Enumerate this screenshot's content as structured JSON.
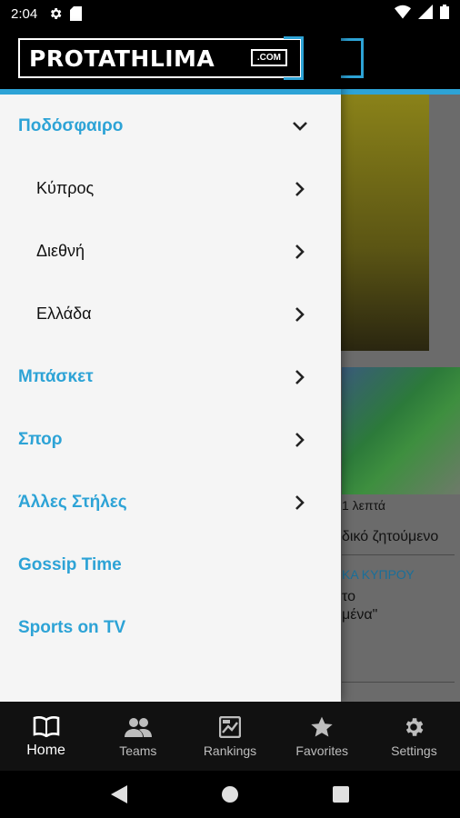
{
  "status_bar": {
    "time": "2:04"
  },
  "background": {
    "time_ago": "1 λεπτά",
    "headline_fragment": "δικό ζητούμενο",
    "category_fragment": "ΚΑ ΚΥΠΡΟΥ",
    "teaser_line1": "το",
    "teaser_line2": "μένα\""
  },
  "drawer": {
    "logo_text": "PROTATHLIMA",
    "logo_tld": ".COM",
    "menu": [
      {
        "label": "Ποδόσφαιρο",
        "icon": "chevron-down-icon",
        "level": "top"
      },
      {
        "label": "Κύπρος",
        "icon": "chevron-right-icon",
        "level": "sub"
      },
      {
        "label": "Διεθνή",
        "icon": "chevron-right-icon",
        "level": "sub"
      },
      {
        "label": "Ελλάδα",
        "icon": "chevron-right-icon",
        "level": "sub"
      },
      {
        "label": "Μπάσκετ",
        "icon": "chevron-right-icon",
        "level": "top"
      },
      {
        "label": "Σπορ",
        "icon": "chevron-right-icon",
        "level": "top"
      },
      {
        "label": "Άλλες Στήλες",
        "icon": "chevron-right-icon",
        "level": "top"
      },
      {
        "label": "Gossip Time",
        "icon": "",
        "level": "top"
      },
      {
        "label": "Sports on TV",
        "icon": "",
        "level": "top"
      }
    ]
  },
  "bottom_nav": [
    {
      "label": "Home",
      "icon": "book-icon",
      "active": true
    },
    {
      "label": "Teams",
      "icon": "people-icon",
      "active": false
    },
    {
      "label": "Rankings",
      "icon": "rankings-icon",
      "active": false
    },
    {
      "label": "Favorites",
      "icon": "star-icon",
      "active": false
    },
    {
      "label": "Settings",
      "icon": "gear-icon",
      "active": false
    }
  ],
  "colors": {
    "accent": "#2da3d6",
    "drawer_bg": "#f5f5f5",
    "nav_bg": "#111111"
  }
}
